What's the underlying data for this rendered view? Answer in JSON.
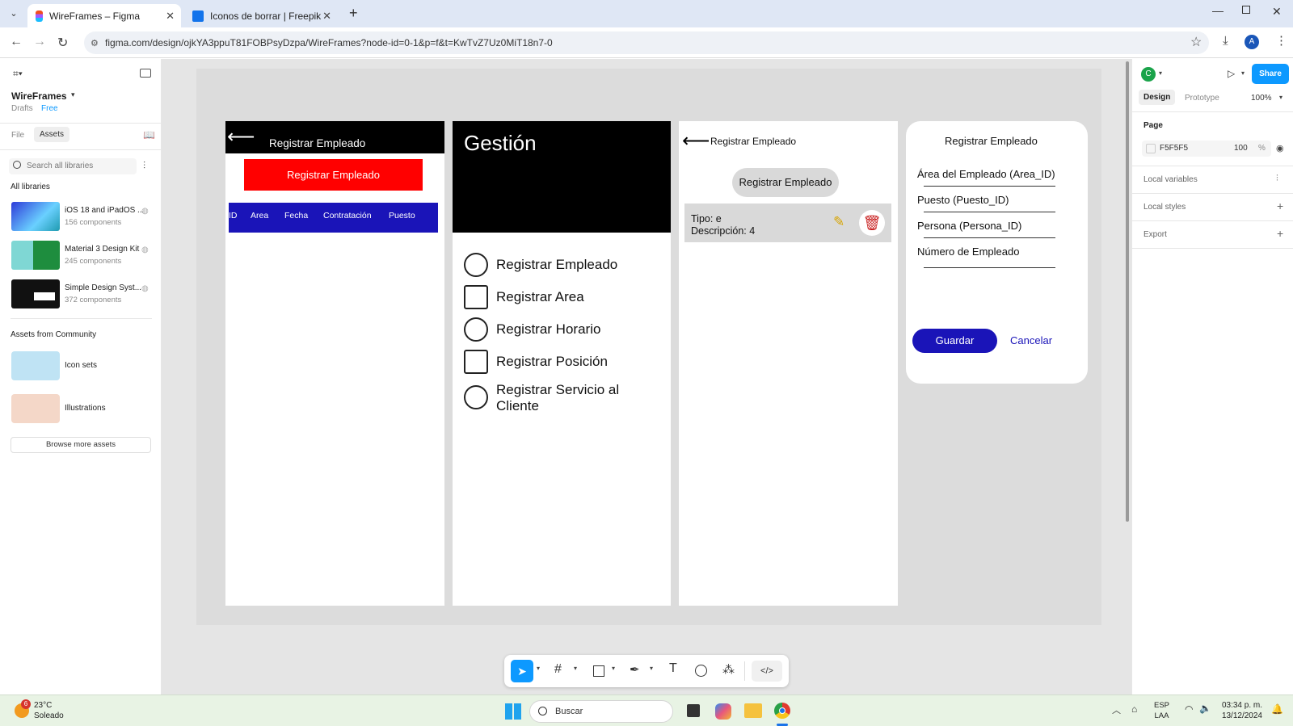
{
  "browser": {
    "tabs": [
      {
        "title": "WireFrames – Figma",
        "active": true
      },
      {
        "title": "Iconos de borrar | Freepik",
        "active": false
      }
    ],
    "url": "figma.com/design/ojkYA3ppuT81FOBPsyDzpa/WireFrames?node-id=0-1&p=f&t=KwTvZ7Uz0MiT18n7-0"
  },
  "left_panel": {
    "file_name": "WireFrames",
    "drafts": "Drafts",
    "plan": "Free",
    "tabs": [
      "File",
      "Assets"
    ],
    "search_placeholder": "Search all libraries",
    "all_libraries": "All libraries",
    "libraries": [
      {
        "name": "iOS 18 and iPadOS ...",
        "count": "156 components"
      },
      {
        "name": "Material 3 Design Kit",
        "count": "245 components"
      },
      {
        "name": "Simple Design Syst...",
        "count": "372 components"
      }
    ],
    "community_heading": "Assets from Community",
    "community": [
      {
        "name": "Icon sets"
      },
      {
        "name": "Illustrations"
      }
    ],
    "browse_button": "Browse more assets"
  },
  "frame1": {
    "title": "Registrar Empleado",
    "red_button": "Registrar Empleado",
    "columns": [
      "ID",
      "Area",
      "Fecha",
      "Contratación",
      "Puesto"
    ]
  },
  "frame2": {
    "title": "Gestión",
    "items": [
      "Registrar Empleado",
      "Registrar Area",
      "Registrar Horario",
      "Registrar Posición",
      "Registrar Servicio al Cliente"
    ]
  },
  "frame3": {
    "title": "Registrar Empleado",
    "button": "Registrar Empleado",
    "card_line1": "Tipo: e",
    "card_line2": "Descripción: 4"
  },
  "frame4": {
    "title": "Registrar Empleado",
    "fields": [
      "Área del Empleado (Area_ID)",
      "Puesto (Puesto_ID)",
      "Persona (Persona_ID)",
      "Número de Empleado"
    ],
    "save": "Guardar",
    "cancel": "Cancelar"
  },
  "right_panel": {
    "avatar": "C",
    "share": "Share",
    "tabs": [
      "Design",
      "Prototype"
    ],
    "zoom": "100%",
    "page_heading": "Page",
    "page_color": "F5F5F5",
    "page_opacity": "100",
    "percent": "%",
    "sections": [
      "Local variables",
      "Local styles",
      "Export"
    ]
  },
  "taskbar": {
    "temp": "23°C",
    "weather": "Soleado",
    "badge": "6",
    "search": "Buscar",
    "lang1": "ESP",
    "lang2": "LAA",
    "time": "03:34 p. m.",
    "date": "13/12/2024"
  },
  "colors": {
    "red": "#ff0000",
    "blue": "#1a14b8",
    "figma_blue": "#0d99ff",
    "black": "#000000"
  }
}
